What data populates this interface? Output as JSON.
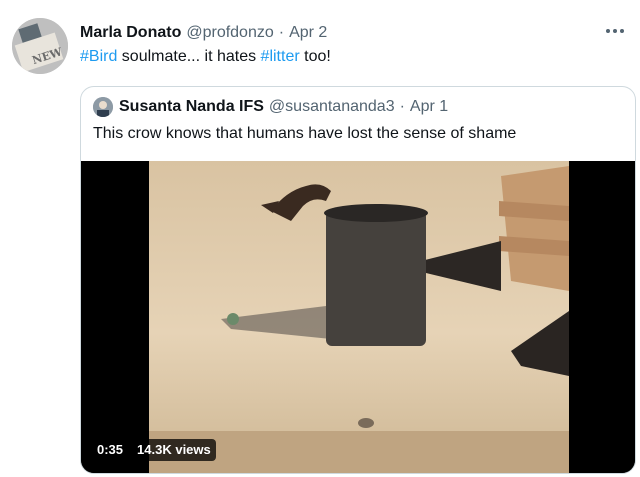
{
  "tweet": {
    "author": {
      "display_name": "Marla Donato",
      "handle": "@profdonzo",
      "date": "Apr 2"
    },
    "text_parts": [
      {
        "text": "#Bird",
        "type": "hashtag"
      },
      {
        "text": " soulmate... it hates ",
        "type": "plain"
      },
      {
        "text": "#litter",
        "type": "hashtag"
      },
      {
        "text": " too!",
        "type": "plain"
      }
    ],
    "more_icon": "more-horizontal-icon"
  },
  "quote": {
    "author": {
      "display_name": "Susanta Nanda IFS",
      "handle": "@susantananda3",
      "date": "Apr 1"
    },
    "text": "This crow knows that humans have lost the sense of shame",
    "video": {
      "duration": "0:35",
      "views": "14.3K views"
    }
  },
  "separator": "·",
  "colors": {
    "link": "#1d9bf0",
    "secondary_text": "#536471",
    "border": "#cfd9de"
  }
}
